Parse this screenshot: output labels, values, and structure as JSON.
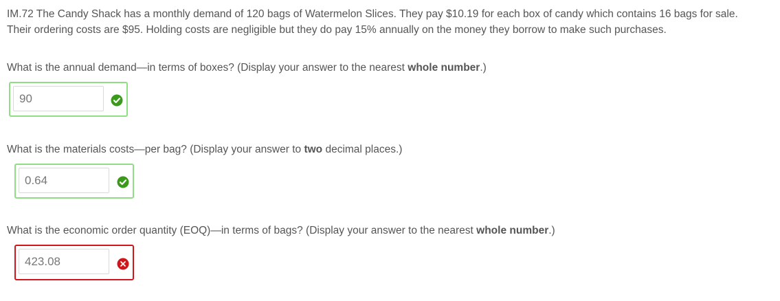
{
  "problem": {
    "line1": "IM.72  The Candy Shack has a monthly demand of 120 bags of Watermelon Slices. They pay $10.19 for each box of candy which contains 16 bags for sale.",
    "line2": "Their ordering costs are $95. Holding costs are negligible but they do pay 15% annually on the money they borrow to make such purchases."
  },
  "questions": [
    {
      "pre": "What is the annual demand—in terms of boxes? (Display your answer to the nearest ",
      "bold": "whole number",
      "post": ".)",
      "answer": "90",
      "status": "correct"
    },
    {
      "pre": "What is the materials costs—per bag? (Display your answer to ",
      "bold": "two",
      "post": " decimal places.)",
      "answer": "0.64",
      "status": "correct"
    },
    {
      "pre": "What is the economic order quantity (EOQ)—in terms of bags? (Display your answer to the nearest ",
      "bold": "whole number",
      "post": ".)",
      "answer": "423.08",
      "status": "incorrect"
    }
  ],
  "icons": {
    "correct": "check-circle-icon",
    "incorrect": "x-circle-icon"
  },
  "colors": {
    "text": "#555555",
    "correct_border": "#8fdd84",
    "correct_icon": "#3b9a1c",
    "incorrect_border": "#d0161b",
    "incorrect_icon": "#d0161b"
  }
}
